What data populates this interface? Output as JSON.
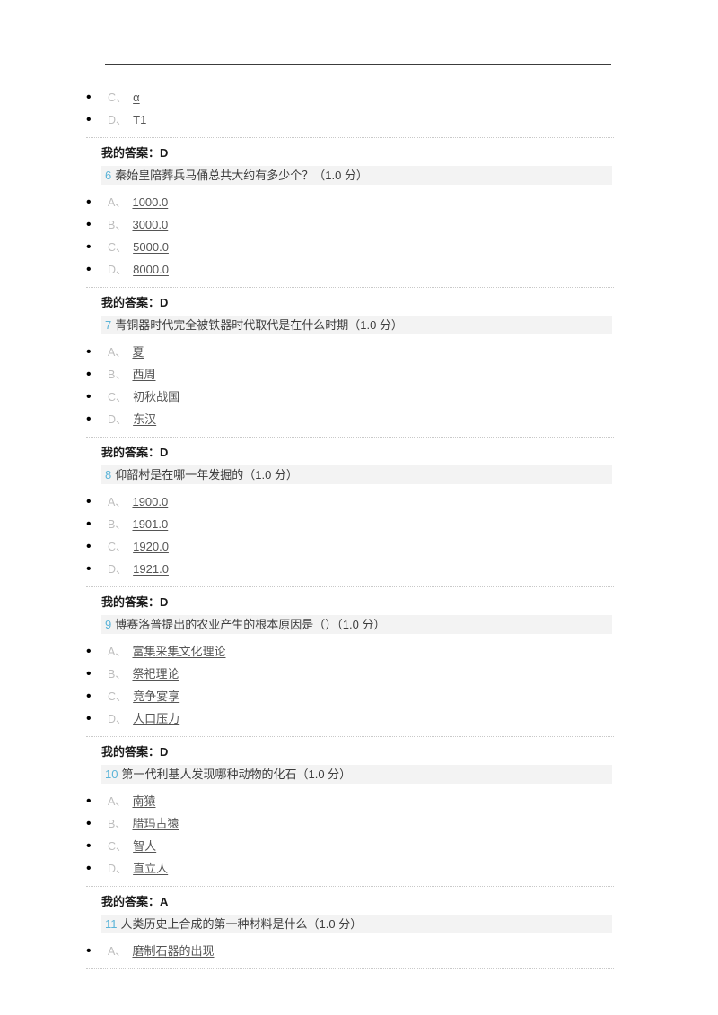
{
  "page": {
    "separator_top": "horizontal-rule",
    "answer_label": "我的答案：",
    "bullet_glyph": "•"
  },
  "leading_options": [
    {
      "letter": "C、",
      "text": "α"
    },
    {
      "letter": "D、",
      "text": "T1"
    }
  ],
  "leading_answer": {
    "label": "我的答案：",
    "value": "D"
  },
  "questions": [
    {
      "number": "6",
      "text": "秦始皇陪葬兵马俑总共大约有多少个？",
      "score": "（1.0 分）",
      "options": [
        {
          "letter": "A、",
          "text": "1000.0"
        },
        {
          "letter": "B、",
          "text": "3000.0"
        },
        {
          "letter": "C、",
          "text": "5000.0"
        },
        {
          "letter": "D、",
          "text": "8000.0"
        }
      ],
      "answer": {
        "label": "我的答案：",
        "value": "D"
      }
    },
    {
      "number": "7",
      "text": "青铜器时代完全被铁器时代取代是在什么时期",
      "score": "（1.0 分）",
      "options": [
        {
          "letter": "A、",
          "text": "夏"
        },
        {
          "letter": "B、",
          "text": "西周"
        },
        {
          "letter": "C、",
          "text": "初秋战国"
        },
        {
          "letter": "D、",
          "text": "东汉"
        }
      ],
      "answer": {
        "label": "我的答案：",
        "value": "D"
      }
    },
    {
      "number": "8",
      "text": "仰韶村是在哪一年发掘的",
      "score": "（1.0 分）",
      "options": [
        {
          "letter": "A、",
          "text": "1900.0"
        },
        {
          "letter": "B、",
          "text": "1901.0"
        },
        {
          "letter": "C、",
          "text": "1920.0"
        },
        {
          "letter": "D、",
          "text": "1921.0"
        }
      ],
      "answer": {
        "label": "我的答案：",
        "value": "D"
      }
    },
    {
      "number": "9",
      "text": "博赛洛普提出的农业产生的根本原因是（）",
      "score": "（1.0 分）",
      "options": [
        {
          "letter": "A、",
          "text": "富集采集文化理论"
        },
        {
          "letter": "B、",
          "text": "祭祀理论"
        },
        {
          "letter": "C、",
          "text": "竞争宴享"
        },
        {
          "letter": "D、",
          "text": "人口压力"
        }
      ],
      "answer": {
        "label": "我的答案：",
        "value": "D"
      }
    },
    {
      "number": "10",
      "text": "第一代利基人发现哪种动物的化石",
      "score": "（1.0 分）",
      "options": [
        {
          "letter": "A、",
          "text": "南猿"
        },
        {
          "letter": "B、",
          "text": "腊玛古猿"
        },
        {
          "letter": "C、",
          "text": "智人"
        },
        {
          "letter": "D、",
          "text": "直立人"
        }
      ],
      "answer": {
        "label": "我的答案：",
        "value": "A"
      }
    },
    {
      "number": "11",
      "text": "人类历史上合成的第一种材料是什么",
      "score": "（1.0 分）",
      "options": [
        {
          "letter": "A、",
          "text": "磨制石器的出现"
        }
      ],
      "answer": null
    }
  ]
}
